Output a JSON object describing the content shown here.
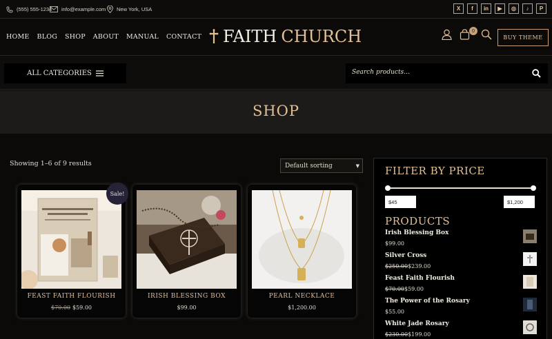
{
  "topbar": {
    "phone": "(555) 555-1234",
    "email": "info@example.com",
    "location": "New York, USA",
    "social": [
      "X",
      "f",
      "in",
      "▶",
      "◎",
      "♪",
      "P"
    ]
  },
  "header": {
    "nav": [
      "HOME",
      "BLOG",
      "SHOP",
      "ABOUT",
      "MANUAL",
      "CONTACT"
    ],
    "logo_word1": "FAITH",
    "logo_word2": "CHURCH",
    "cart_count": "0",
    "buy_label": "BUY THEME"
  },
  "subbar": {
    "categories_label": "ALL CATEGORIES",
    "search_placeholder": "Search products..."
  },
  "page_title": "SHOP",
  "toolbar": {
    "showing": "Showing 1–6 of 9 results",
    "sort": "Default sorting"
  },
  "products": [
    {
      "title": "FEAST FAITH FLOURISH",
      "old_price": "$70.00",
      "price": "$59.00",
      "sale": "Sale!"
    },
    {
      "title": "IRISH BLESSING BOX",
      "old_price": "",
      "price": "$99.00"
    },
    {
      "title": "PEARL NECKLACE",
      "old_price": "",
      "price": "$1,200.00"
    }
  ],
  "sidebar": {
    "filter_title": "FILTER BY PRICE",
    "min_price": "$45",
    "max_price": "$1,200",
    "products_title": "PRODUCTS",
    "items": [
      {
        "name": "Irish Blessing Box",
        "old_price": "",
        "price": "$99.00"
      },
      {
        "name": "Silver Cross",
        "old_price": "$250.00",
        "price": "$239.00"
      },
      {
        "name": "Feast Faith Flourish",
        "old_price": "$70.00",
        "price": "$59.00"
      },
      {
        "name": "The Power of the Rosary",
        "old_price": "",
        "price": "$55.00"
      },
      {
        "name": "White Jade Rosary",
        "old_price": "$230.00",
        "price": "$199.00"
      }
    ]
  },
  "colors": {
    "accent": "#e3bf95",
    "background": "#0b0a09"
  }
}
